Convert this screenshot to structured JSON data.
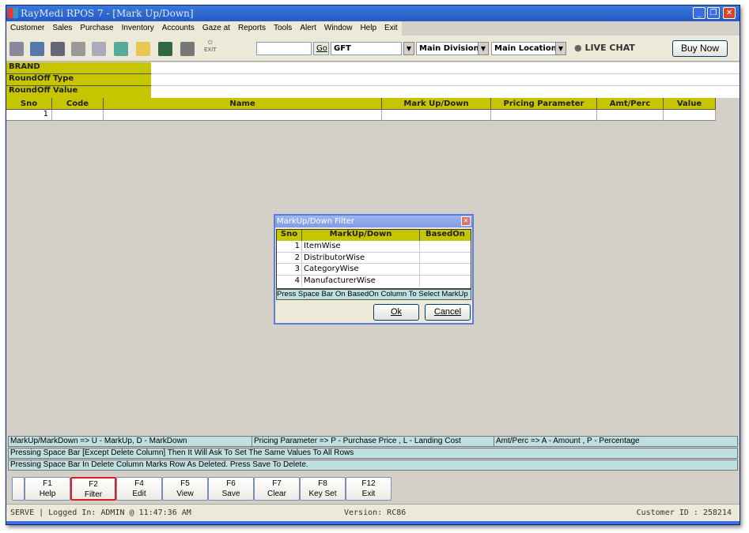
{
  "window": {
    "title": "RayMedi RPOS 7 - [Mark Up/Down]"
  },
  "menu": [
    "Customer",
    "Sales",
    "Purchase",
    "Inventory",
    "Accounts",
    "Gaze at",
    "Reports",
    "Tools",
    "Alert",
    "Window",
    "Help",
    "Exit"
  ],
  "toolbar": {
    "search_value": "",
    "go": "Go",
    "store": "GFT",
    "division": "Main Division",
    "location": "Main Location",
    "live_chat": "LIVE CHAT",
    "buy_now": "Buy Now",
    "exit_icon_label": "EXIT"
  },
  "fields": {
    "brand": "BRAND",
    "roundoff_type": "RoundOff Type",
    "roundoff_value": "RoundOff Value"
  },
  "grid": {
    "columns": [
      "Sno",
      "Code",
      "Name",
      "Mark Up/Down",
      "Pricing Parameter",
      "Amt/Perc",
      "Value"
    ],
    "rows": [
      [
        "1",
        "",
        "",
        "",
        "",
        "",
        ""
      ]
    ]
  },
  "dialog": {
    "title": "MarkUp/Down Filter",
    "columns": [
      "Sno",
      "MarkUp/Down",
      "BasedOn"
    ],
    "rows": [
      [
        "1",
        "ItemWise",
        ""
      ],
      [
        "2",
        "DistributorWise",
        ""
      ],
      [
        "3",
        "CategoryWise",
        ""
      ],
      [
        "4",
        "ManufacturerWise",
        ""
      ]
    ],
    "hint": "Press Space Bar On BasedOn Column To Select MarkUp",
    "ok": "Ok",
    "cancel": "Cancel"
  },
  "info": {
    "markup": "MarkUp/MarkDown => U - MarkUp, D - MarkDown",
    "pricing": "Pricing Parameter => P - Purchase Price , L - Landing Cost",
    "amt": "Amt/Perc => A - Amount , P - Percentage",
    "line2": "Pressing Space Bar [Except Delete Column] Then It Will Ask To Set The Same Values To All Rows",
    "line3": "Pressing Space Bar In Delete Column Marks Row As Deleted. Press Save To Delete."
  },
  "fkeys": [
    {
      "key": "F1",
      "label": "Help"
    },
    {
      "key": "F2",
      "label": "Filter"
    },
    {
      "key": "F4",
      "label": "Edit"
    },
    {
      "key": "F5",
      "label": "View"
    },
    {
      "key": "F6",
      "label": "Save"
    },
    {
      "key": "F7",
      "label": "Clear"
    },
    {
      "key": "F8",
      "label": "Key Set"
    },
    {
      "key": "F12",
      "label": "Exit"
    }
  ],
  "status": {
    "left": "SERVE |  Logged In: ADMIN  @ 11:47:36 AM",
    "version": "Version: RC86",
    "customer": "Customer ID : 258214"
  },
  "colors": {
    "header": "#c7c400",
    "info": "#bfe0e0",
    "highlight": "#e02020"
  }
}
